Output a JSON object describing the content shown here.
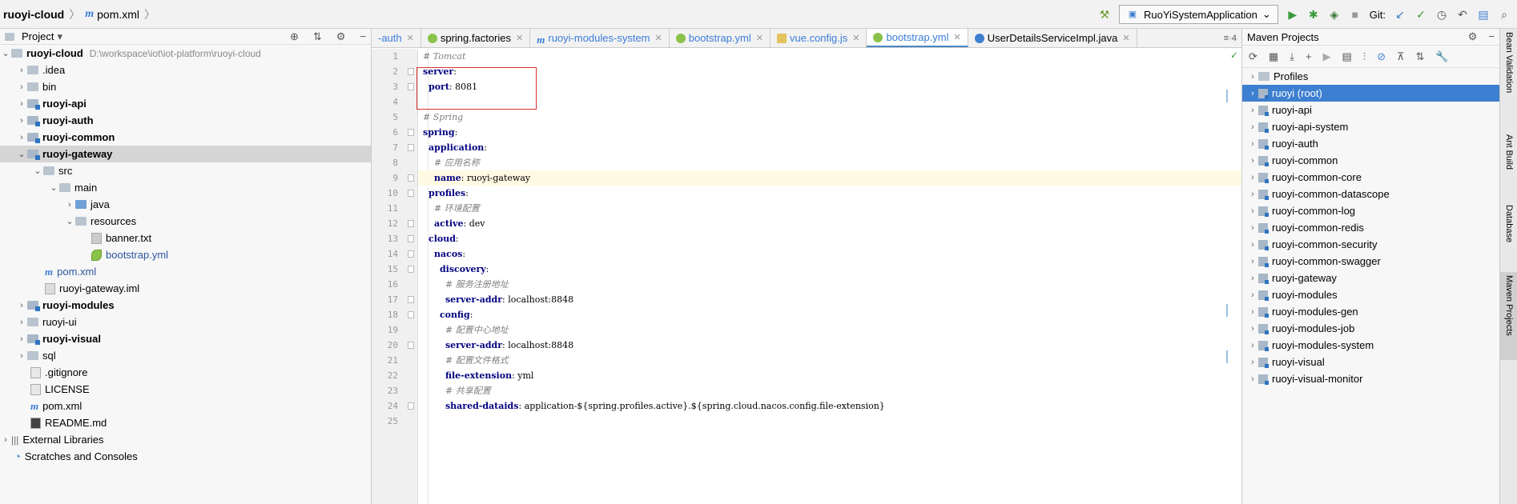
{
  "breadcrumb": {
    "project": "ruoyi-cloud",
    "file": "pom.xml",
    "file_icon": "m"
  },
  "toolbar": {
    "run_config": "RuoYiSystemApplication",
    "git_label": "Git:"
  },
  "project_panel": {
    "title": "Project",
    "root": {
      "name": "ruoyi-cloud",
      "path": "D:\\workspace\\iot\\iot-platform\\ruoyi-cloud"
    },
    "items": [
      {
        "label": ".idea"
      },
      {
        "label": "bin"
      },
      {
        "label": "ruoyi-api"
      },
      {
        "label": "ruoyi-auth"
      },
      {
        "label": "ruoyi-common"
      },
      {
        "label": "ruoyi-gateway"
      },
      {
        "label": "src"
      },
      {
        "label": "main"
      },
      {
        "label": "java"
      },
      {
        "label": "resources"
      },
      {
        "label": "banner.txt"
      },
      {
        "label": "bootstrap.yml"
      },
      {
        "label": "pom.xml"
      },
      {
        "label": "ruoyi-gateway.iml"
      },
      {
        "label": "ruoyi-modules"
      },
      {
        "label": "ruoyi-ui"
      },
      {
        "label": "ruoyi-visual"
      },
      {
        "label": "sql"
      },
      {
        "label": ".gitignore"
      },
      {
        "label": "LICENSE"
      },
      {
        "label": "pom.xml"
      },
      {
        "label": "README.md"
      },
      {
        "label": "External Libraries"
      },
      {
        "label": "Scratches and Consoles"
      }
    ]
  },
  "editor_tabs": [
    {
      "label": "-auth"
    },
    {
      "label": "spring.factories"
    },
    {
      "label": "ruoyi-modules-system"
    },
    {
      "label": "bootstrap.yml"
    },
    {
      "label": "vue.config.js"
    },
    {
      "label": "bootstrap.yml"
    },
    {
      "label": "UserDetailsServiceImpl.java"
    }
  ],
  "tabs_more": "≡·4",
  "code_lines": [
    {
      "n": "1",
      "indent": "",
      "comment": "# Tomcat"
    },
    {
      "n": "2",
      "indent": "",
      "key": "server",
      "sep": ":"
    },
    {
      "n": "3",
      "indent": "  ",
      "key": "port",
      "sep": ": ",
      "value": "8081"
    },
    {
      "n": "4",
      "indent": ""
    },
    {
      "n": "5",
      "indent": "",
      "comment": "# Spring"
    },
    {
      "n": "6",
      "indent": "",
      "key": "spring",
      "sep": ":"
    },
    {
      "n": "7",
      "indent": "  ",
      "key": "application",
      "sep": ":"
    },
    {
      "n": "8",
      "indent": "    ",
      "comment": "# 应用名称"
    },
    {
      "n": "9",
      "indent": "    ",
      "key": "name",
      "sep": ": ",
      "value": "ruoyi-gateway"
    },
    {
      "n": "10",
      "indent": "  ",
      "key": "profiles",
      "sep": ":"
    },
    {
      "n": "11",
      "indent": "    ",
      "comment": "# 环境配置"
    },
    {
      "n": "12",
      "indent": "    ",
      "key": "active",
      "sep": ": ",
      "value": "dev"
    },
    {
      "n": "13",
      "indent": "  ",
      "key": "cloud",
      "sep": ":"
    },
    {
      "n": "14",
      "indent": "    ",
      "key": "nacos",
      "sep": ":"
    },
    {
      "n": "15",
      "indent": "      ",
      "key": "discovery",
      "sep": ":"
    },
    {
      "n": "16",
      "indent": "        ",
      "comment": "# 服务注册地址"
    },
    {
      "n": "17",
      "indent": "        ",
      "key": "server-addr",
      "sep": ": ",
      "value": "localhost:8848"
    },
    {
      "n": "18",
      "indent": "      ",
      "key": "config",
      "sep": ":"
    },
    {
      "n": "19",
      "indent": "        ",
      "comment": "# 配置中心地址"
    },
    {
      "n": "20",
      "indent": "        ",
      "key": "server-addr",
      "sep": ": ",
      "value": "localhost:8848"
    },
    {
      "n": "21",
      "indent": "        ",
      "comment": "# 配置文件格式"
    },
    {
      "n": "22",
      "indent": "        ",
      "key": "file-extension",
      "sep": ": ",
      "value": "yml"
    },
    {
      "n": "23",
      "indent": "        ",
      "comment": "# 共享配置"
    },
    {
      "n": "24",
      "indent": "        ",
      "key": "shared-dataids",
      "sep": ": ",
      "value": "application-${spring.profiles.active}.${spring.cloud.nacos.config.file-extension}"
    },
    {
      "n": "25",
      "indent": ""
    }
  ],
  "maven_panel": {
    "title": "Maven Projects",
    "items": [
      {
        "label": "Profiles"
      },
      {
        "label": "ruoyi (root)"
      },
      {
        "label": "ruoyi-api"
      },
      {
        "label": "ruoyi-api-system"
      },
      {
        "label": "ruoyi-auth"
      },
      {
        "label": "ruoyi-common"
      },
      {
        "label": "ruoyi-common-core"
      },
      {
        "label": "ruoyi-common-datascope"
      },
      {
        "label": "ruoyi-common-log"
      },
      {
        "label": "ruoyi-common-redis"
      },
      {
        "label": "ruoyi-common-security"
      },
      {
        "label": "ruoyi-common-swagger"
      },
      {
        "label": "ruoyi-gateway"
      },
      {
        "label": "ruoyi-modules"
      },
      {
        "label": "ruoyi-modules-gen"
      },
      {
        "label": "ruoyi-modules-job"
      },
      {
        "label": "ruoyi-modules-system"
      },
      {
        "label": "ruoyi-visual"
      },
      {
        "label": "ruoyi-visual-monitor"
      }
    ]
  },
  "side_tabs": [
    "Bean Validation",
    "Ant Build",
    "Database",
    "Maven Projects"
  ],
  "colors": {
    "accent": "#3d7fd0",
    "highlight_box": "#d93030",
    "yaml_key": "#000080",
    "comment": "#808080"
  }
}
